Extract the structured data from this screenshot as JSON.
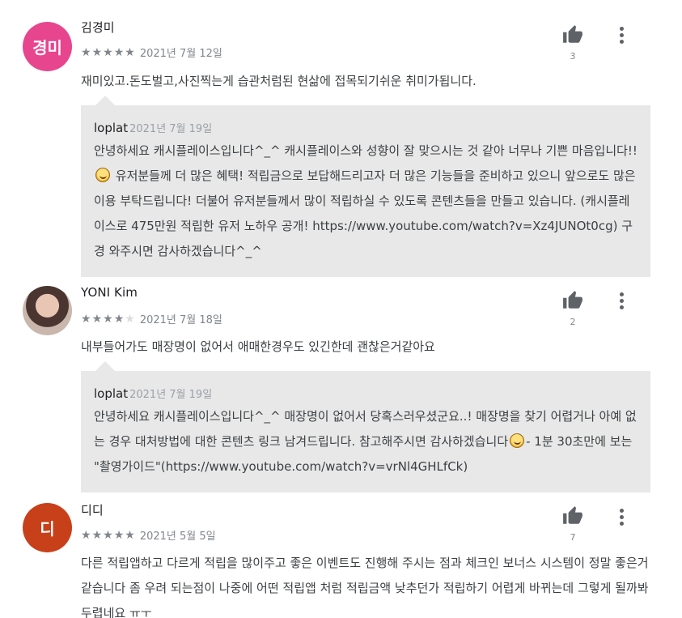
{
  "colors": {
    "avatar_1": "#e8458f",
    "avatar_3": "#c8401a",
    "reply_bg": "#e8e8e8",
    "star_on": "#80868b",
    "star_off": "#dadce0"
  },
  "icons": {
    "helpful": "thumbs-up-icon",
    "more": "more-vert-icon",
    "emoji": "smile-emoji-icon"
  },
  "reviews": [
    {
      "avatar_text": "경미",
      "name": "김경미",
      "rating": 5,
      "date": "2021년 7월 12일",
      "helpful_count": "3",
      "text": "재미있고.돈도벌고,사진찍는게 습관처럼된 현삶에 접목되기쉬운 취미가됩니다.",
      "reply": {
        "author": "loplat",
        "date": "2021년 7월 19일",
        "text_a": "안녕하세요 캐시플레이스입니다^_^ 캐시플레이스와 성향이 잘 맞으시는 것 같아 너무나 기쁜 마음입니다!!",
        "text_b": " 유저분들께 더 많은 혜택! 적립금으로 보답해드리고자 더 많은 기능들을 준비하고 있으니 앞으로도 많은 이용 부탁드립니다! 더불어 유저분들께서 많이 적립하실 수 있도록 콘텐츠들을 만들고 있습니다. (캐시플레이스로 475만원 적립한 유저 노하우 공개! https://www.youtube.com/watch?v=Xz4JUNOt0cg) 구경 와주시면 감사하겠습니다^_^"
      }
    },
    {
      "avatar_text": "",
      "name": "YONI Kim",
      "rating": 4,
      "date": "2021년 7월 18일",
      "helpful_count": "2",
      "text": "내부들어가도 매장명이 없어서 애매한경우도 있긴한데 괜찮은거같아요",
      "reply": {
        "author": "loplat",
        "date": "2021년 7월 19일",
        "text_a": "안녕하세요 캐시플레이스입니다^_^ 매장명이 없어서 당혹스러우셨군요..! 매장명을 찾기 어렵거나 아예 없는 경우 대처방법에 대한 콘텐츠 링크 남겨드립니다. 참고해주시면 감사하겠습니다",
        "text_b": "- 1분 30초만에 보는 \"촬영가이드\"(https://www.youtube.com/watch?v=vrNl4GHLfCk)"
      }
    },
    {
      "avatar_text": "디",
      "name": "디디",
      "rating": 5,
      "date": "2021년 5월 5일",
      "helpful_count": "7",
      "text": "다른 적립앱하고 다르게 적립을 많이주고 좋은 이벤트도 진행해 주시는 점과 체크인 보너스 시스템이 정말 좋은거 같습니다 좀 우려 되는점이 나중에 어떤 적립앱 처럼 적립금액 낮추던가 적립하기 어렵게 바뀌는데 그렇게 될까봐 두렵네요 ㅠㅜ"
    }
  ]
}
